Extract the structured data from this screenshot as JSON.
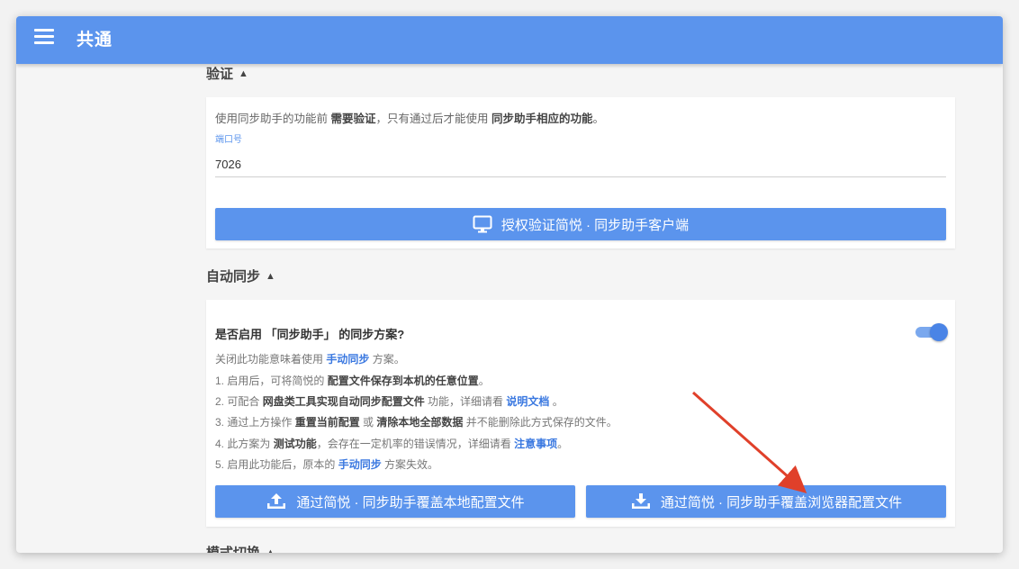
{
  "app": {
    "title": "共通"
  },
  "verify": {
    "heading": "验证",
    "desc_1": "使用同步助手的功能前",
    "desc_2": "需要验证",
    "desc_3": "，只有通过后才能使用",
    "desc_4": "同步助手相应的功能",
    "desc_5": "。",
    "port_label": "端口号",
    "port_value": "7026",
    "auth_button": "授权验证简悦 · 同步助手客户端"
  },
  "autosync": {
    "heading": "自动同步",
    "question": "是否启用 「同步助手」 的同步方案?",
    "toggle_on": true,
    "l0_a": "关闭此功能意味着使用",
    "l0_link": "手动同步",
    "l0_b": "方案。",
    "l1_a": "1. 启用后，可将简悦的",
    "l1_b": "配置文件保存到本机的任意位置",
    "l1_c": "。",
    "l2_a": "2. 可配合",
    "l2_b": "网盘类工具实现自动同步配置文件",
    "l2_c": "功能，详细请看",
    "l2_link": "说明文档",
    "l2_d": "。",
    "l3_a": "3. 通过上方操作",
    "l3_b": "重置当前配置",
    "l3_c": "或",
    "l3_d": "清除本地全部数据",
    "l3_e": "并不能删除此方式保存的文件。",
    "l4_a": "4. 此方案为",
    "l4_b": "测试功能",
    "l4_c": "，会存在一定机率的错误情况，详细请看",
    "l4_link": "注意事项",
    "l4_d": "。",
    "l5_a": "5. 启用此功能后，原本的",
    "l5_link": "手动同步",
    "l5_b": "方案失效。",
    "upload_button": "通过简悦 · 同步助手覆盖本地配置文件",
    "download_button": "通过简悦 · 同步助手覆盖浏览器配置文件"
  },
  "mode": {
    "heading": "模式切换"
  },
  "colors": {
    "primary": "#5b94ed",
    "annotation_arrow": "#e0402a"
  }
}
